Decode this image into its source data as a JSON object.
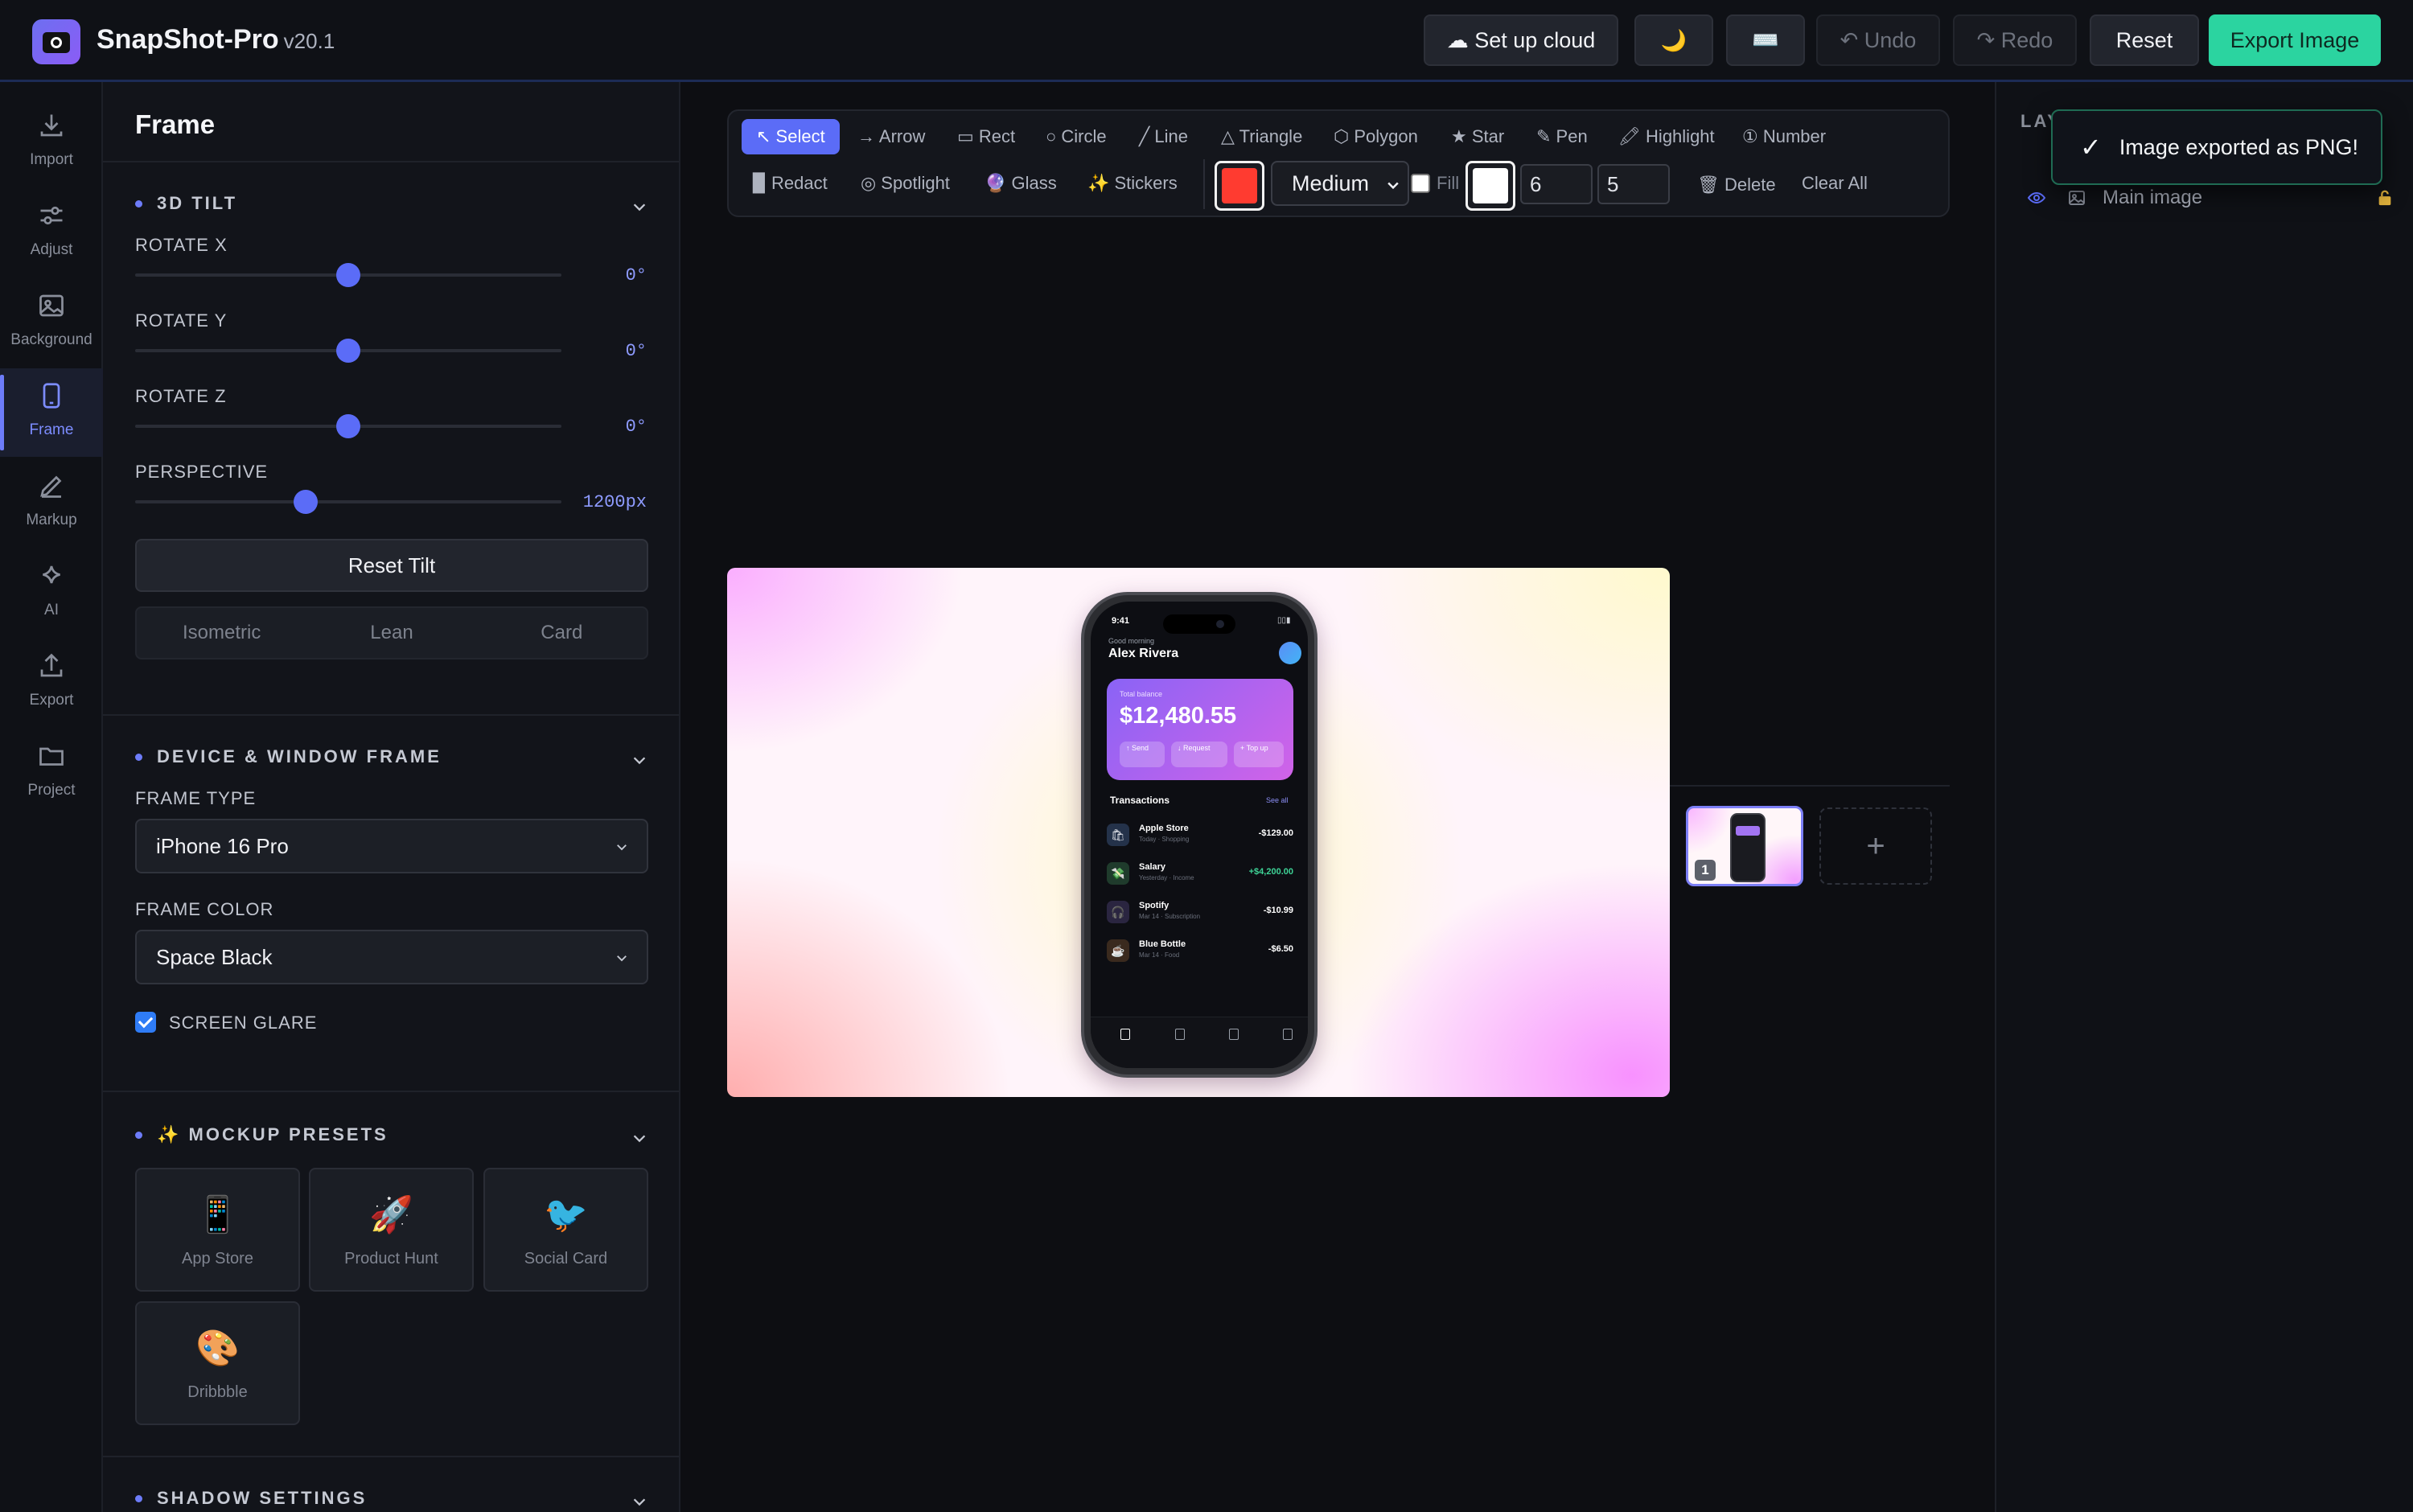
{
  "header": {
    "app_name": "SnapShot-Pro",
    "version": "v20.1",
    "cloud_label": "☁ Set up cloud",
    "theme_icon": "🌙",
    "keyboard_icon": "⌨️",
    "undo_label": "↶ Undo",
    "redo_label": "↷ Redo",
    "reset_label": "Reset",
    "export_label": "Export Image",
    "export_color": "#2bd4a0"
  },
  "rail": {
    "items": [
      {
        "label": "Import",
        "icon": "import-icon"
      },
      {
        "label": "Adjust",
        "icon": "sliders-icon"
      },
      {
        "label": "Background",
        "icon": "image-icon"
      },
      {
        "label": "Frame",
        "icon": "phone-icon",
        "active": true
      },
      {
        "label": "Markup",
        "icon": "pen-icon"
      },
      {
        "label": "AI",
        "icon": "sparkle-icon"
      },
      {
        "label": "Export",
        "icon": "upload-icon"
      },
      {
        "label": "Project",
        "icon": "folder-icon"
      }
    ]
  },
  "panel": {
    "title": "Frame",
    "tilt": {
      "title": "3D TILT",
      "rotate_x_label": "ROTATE X",
      "rotate_x_value": "0°",
      "rotate_x_level": 0.5,
      "rotate_y_label": "ROTATE Y",
      "rotate_y_value": "0°",
      "rotate_y_level": 0.5,
      "rotate_z_label": "ROTATE Z",
      "rotate_z_value": "0°",
      "rotate_z_level": 0.5,
      "perspective_label": "PERSPECTIVE",
      "perspective_value": "1200px",
      "perspective_level": 0.4,
      "reset_label": "Reset Tilt",
      "presets": [
        "Isometric",
        "Lean",
        "Card"
      ]
    },
    "device": {
      "title": "DEVICE & WINDOW FRAME",
      "frame_type_label": "FRAME TYPE",
      "frame_type_value": "iPhone 16 Pro",
      "frame_color_label": "FRAME COLOR",
      "frame_color_value": "Space Black",
      "screen_glare_label": "SCREEN GLARE",
      "screen_glare_checked": true
    },
    "mockups": {
      "title": "✨ MOCKUP PRESETS",
      "items": [
        {
          "emoji": "📱",
          "label": "App Store"
        },
        {
          "emoji": "🚀",
          "label": "Product Hunt"
        },
        {
          "emoji": "🐦",
          "label": "Social Card"
        },
        {
          "emoji": "🎨",
          "label": "Dribbble"
        }
      ]
    },
    "shadow": {
      "title": "SHADOW SETTINGS"
    }
  },
  "toolbar": {
    "row1": [
      "↖ Select",
      "→ Arrow",
      "▭ Rect",
      "○ Circle",
      "╱ Line",
      "△ Triangle",
      "⬡ Polygon",
      "★ Star",
      "✎ Pen",
      "🖍 Highlight",
      "① Number"
    ],
    "row2": [
      "▉ Redact",
      "◎ Spotlight",
      "🔮 Glass",
      "✨ Stickers"
    ],
    "stroke_color": "#ff3b30",
    "size_value": "Medium",
    "fill_label": "Fill",
    "fill_color": "#ffffff",
    "input_a": "6",
    "input_b": "5",
    "delete_label": "🗑 Delete",
    "clear_label": "Clear All"
  },
  "phone": {
    "time": "9:41",
    "greeting": "Good morning",
    "user": "Alex Rivera",
    "balance_label": "Total balance",
    "balance": "$12,480.55",
    "actions": [
      "↑ Send",
      "↓ Request",
      "+ Top up"
    ],
    "transactions_title": "Transactions",
    "see_all": "See all",
    "transactions": [
      {
        "icon": "🛍",
        "name": "Apple Store",
        "sub": "Today · Shopping",
        "amount": "-$129.00"
      },
      {
        "icon": "💸",
        "name": "Salary",
        "sub": "Yesterday · Income",
        "amount": "+$4,200.00"
      },
      {
        "icon": "🎧",
        "name": "Spotify",
        "sub": "Mar 14 · Subscription",
        "amount": "-$10.99"
      },
      {
        "icon": "☕",
        "name": "Blue Bottle",
        "sub": "Mar 14 · Food",
        "amount": "-$6.50"
      }
    ]
  },
  "filmstrip": {
    "thumb_number": "1",
    "add_label": "+"
  },
  "layers": {
    "title": "LAYERS",
    "items": [
      {
        "name": "Main image"
      }
    ]
  },
  "toast": {
    "message": "Image exported as PNG!",
    "check": "✓"
  }
}
